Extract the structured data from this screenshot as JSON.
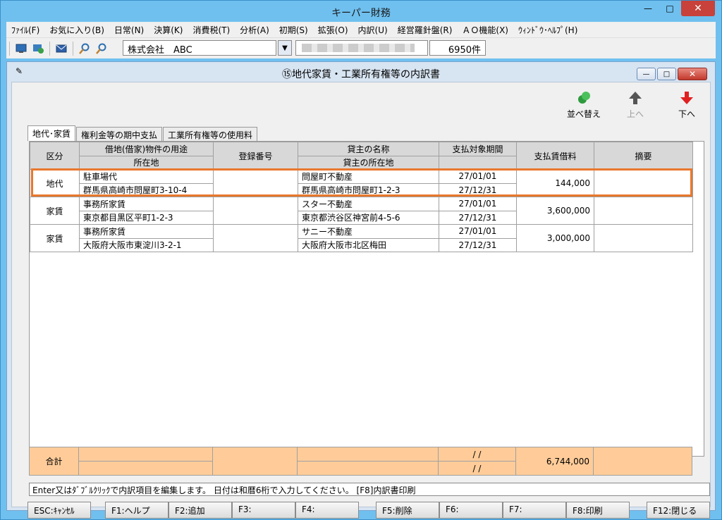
{
  "app": {
    "title": "キーパー財務"
  },
  "menu": [
    "ﾌｧｲﾙ(F)",
    "お気に入り(B)",
    "日常(N)",
    "決算(K)",
    "消費税(T)",
    "分析(A)",
    "初期(S)",
    "拡張(O)",
    "内訳(U)",
    "経営羅針盤(R)",
    "ＡＯ機能(X)",
    "ｳｨﾝﾄﾞｳ･ﾍﾙﾌﾟ(H)"
  ],
  "toolbar": {
    "company": "株式会社　ABC",
    "count": "6950件"
  },
  "child": {
    "title": "⑮地代家賃・工業所有権等の内訳書"
  },
  "actions": {
    "sort": "並べ替え",
    "up": "上へ",
    "down": "下へ"
  },
  "tabs": [
    "地代･家賃",
    "権利金等の期中支払",
    "工業所有権等の使用料"
  ],
  "grid": {
    "headers": {
      "kubun": "区分",
      "use": "借地(借家)物件の用途",
      "location": "所在地",
      "regno": "登録番号",
      "lessor": "貸主の名称",
      "lessor_addr": "貸主の所在地",
      "period": "支払対象期間",
      "amount": "支払賃借料",
      "memo": "摘要"
    },
    "rows": [
      {
        "kubun": "地代",
        "use": "駐車場代",
        "location": "群馬県高崎市問屋町3-10-4",
        "regno": "",
        "lessor": "問屋町不動産",
        "lessor_addr": "群馬県高崎市問屋町1-2-3",
        "from": "27/01/01",
        "to": "27/12/31",
        "amount": "144,000",
        "memo": ""
      },
      {
        "kubun": "家賃",
        "use": "事務所家賃",
        "location": "東京都目黒区平町1-2-3",
        "regno": "",
        "lessor": "スター不動産",
        "lessor_addr": "東京都渋谷区神宮前4-5-6",
        "from": "27/01/01",
        "to": "27/12/31",
        "amount": "3,600,000",
        "memo": ""
      },
      {
        "kubun": "家賃",
        "use": "事務所家賃",
        "location": "大阪府大阪市東淀川3-2-1",
        "regno": "",
        "lessor": "サニー不動産",
        "lessor_addr": "大阪府大阪市北区梅田",
        "from": "27/01/01",
        "to": "27/12/31",
        "amount": "3,000,000",
        "memo": ""
      }
    ]
  },
  "total": {
    "label": "合計",
    "from": "/ /",
    "to": "/ /",
    "amount": "6,744,000"
  },
  "status": "Enter又はﾀﾞﾌﾞﾙｸﾘｯｸで内訳項目を編集します。 日付は和暦6桁で入力してください。 [F8]内訳書印刷",
  "fkeys": {
    "esc": "ESC:ｷｬﾝｾﾙ",
    "f1": "F1:ヘルプ",
    "f2": "F2:追加",
    "f3": "F3:",
    "f4": "F4:",
    "f5": "F5:削除",
    "f6": "F6:",
    "f7": "F7:",
    "f8": "F8:印刷",
    "f12": "F12:閉じる"
  }
}
